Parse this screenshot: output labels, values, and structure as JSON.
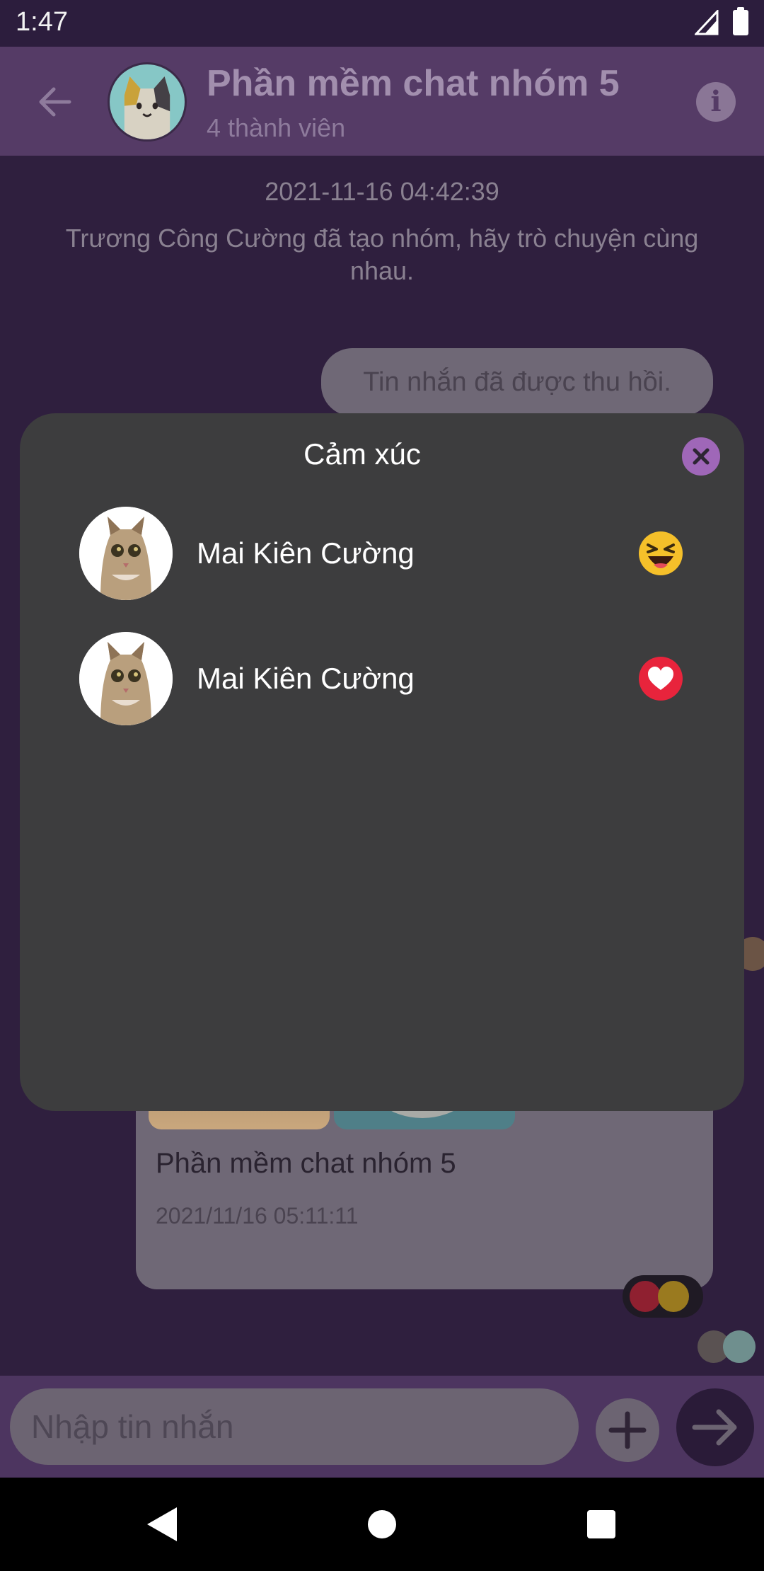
{
  "status_bar": {
    "time": "1:47"
  },
  "header": {
    "title": "Phần mềm chat nhóm 5",
    "subtitle": "4 thành viên",
    "info_glyph": "i"
  },
  "chat": {
    "system_time": "2021-11-16 04:42:39",
    "system_message": "Trương Công Cường đã tạo nhóm, hãy trò chuyện cùng nhau.",
    "revoked_message": "Tin nhắn đã được thu hồi.",
    "image_card": {
      "title": "Phần mềm chat nhóm 5",
      "time": "2021/11/16 05:11:11"
    }
  },
  "input": {
    "placeholder": "Nhập tin nhắn"
  },
  "modal": {
    "title": "Cảm xúc",
    "reactions": [
      {
        "name": "Mai Kiên Cường",
        "emoji": "laughing-face-icon"
      },
      {
        "name": "Mai Kiên Cường",
        "emoji": "heart-icon"
      }
    ]
  },
  "colors": {
    "chat_background": "#2f1f3e",
    "header": "#553b66",
    "modal": "#3d3d3e",
    "close_button": "#9f67b8",
    "heart": "#e8243c",
    "laugh": "#f5c02a"
  }
}
